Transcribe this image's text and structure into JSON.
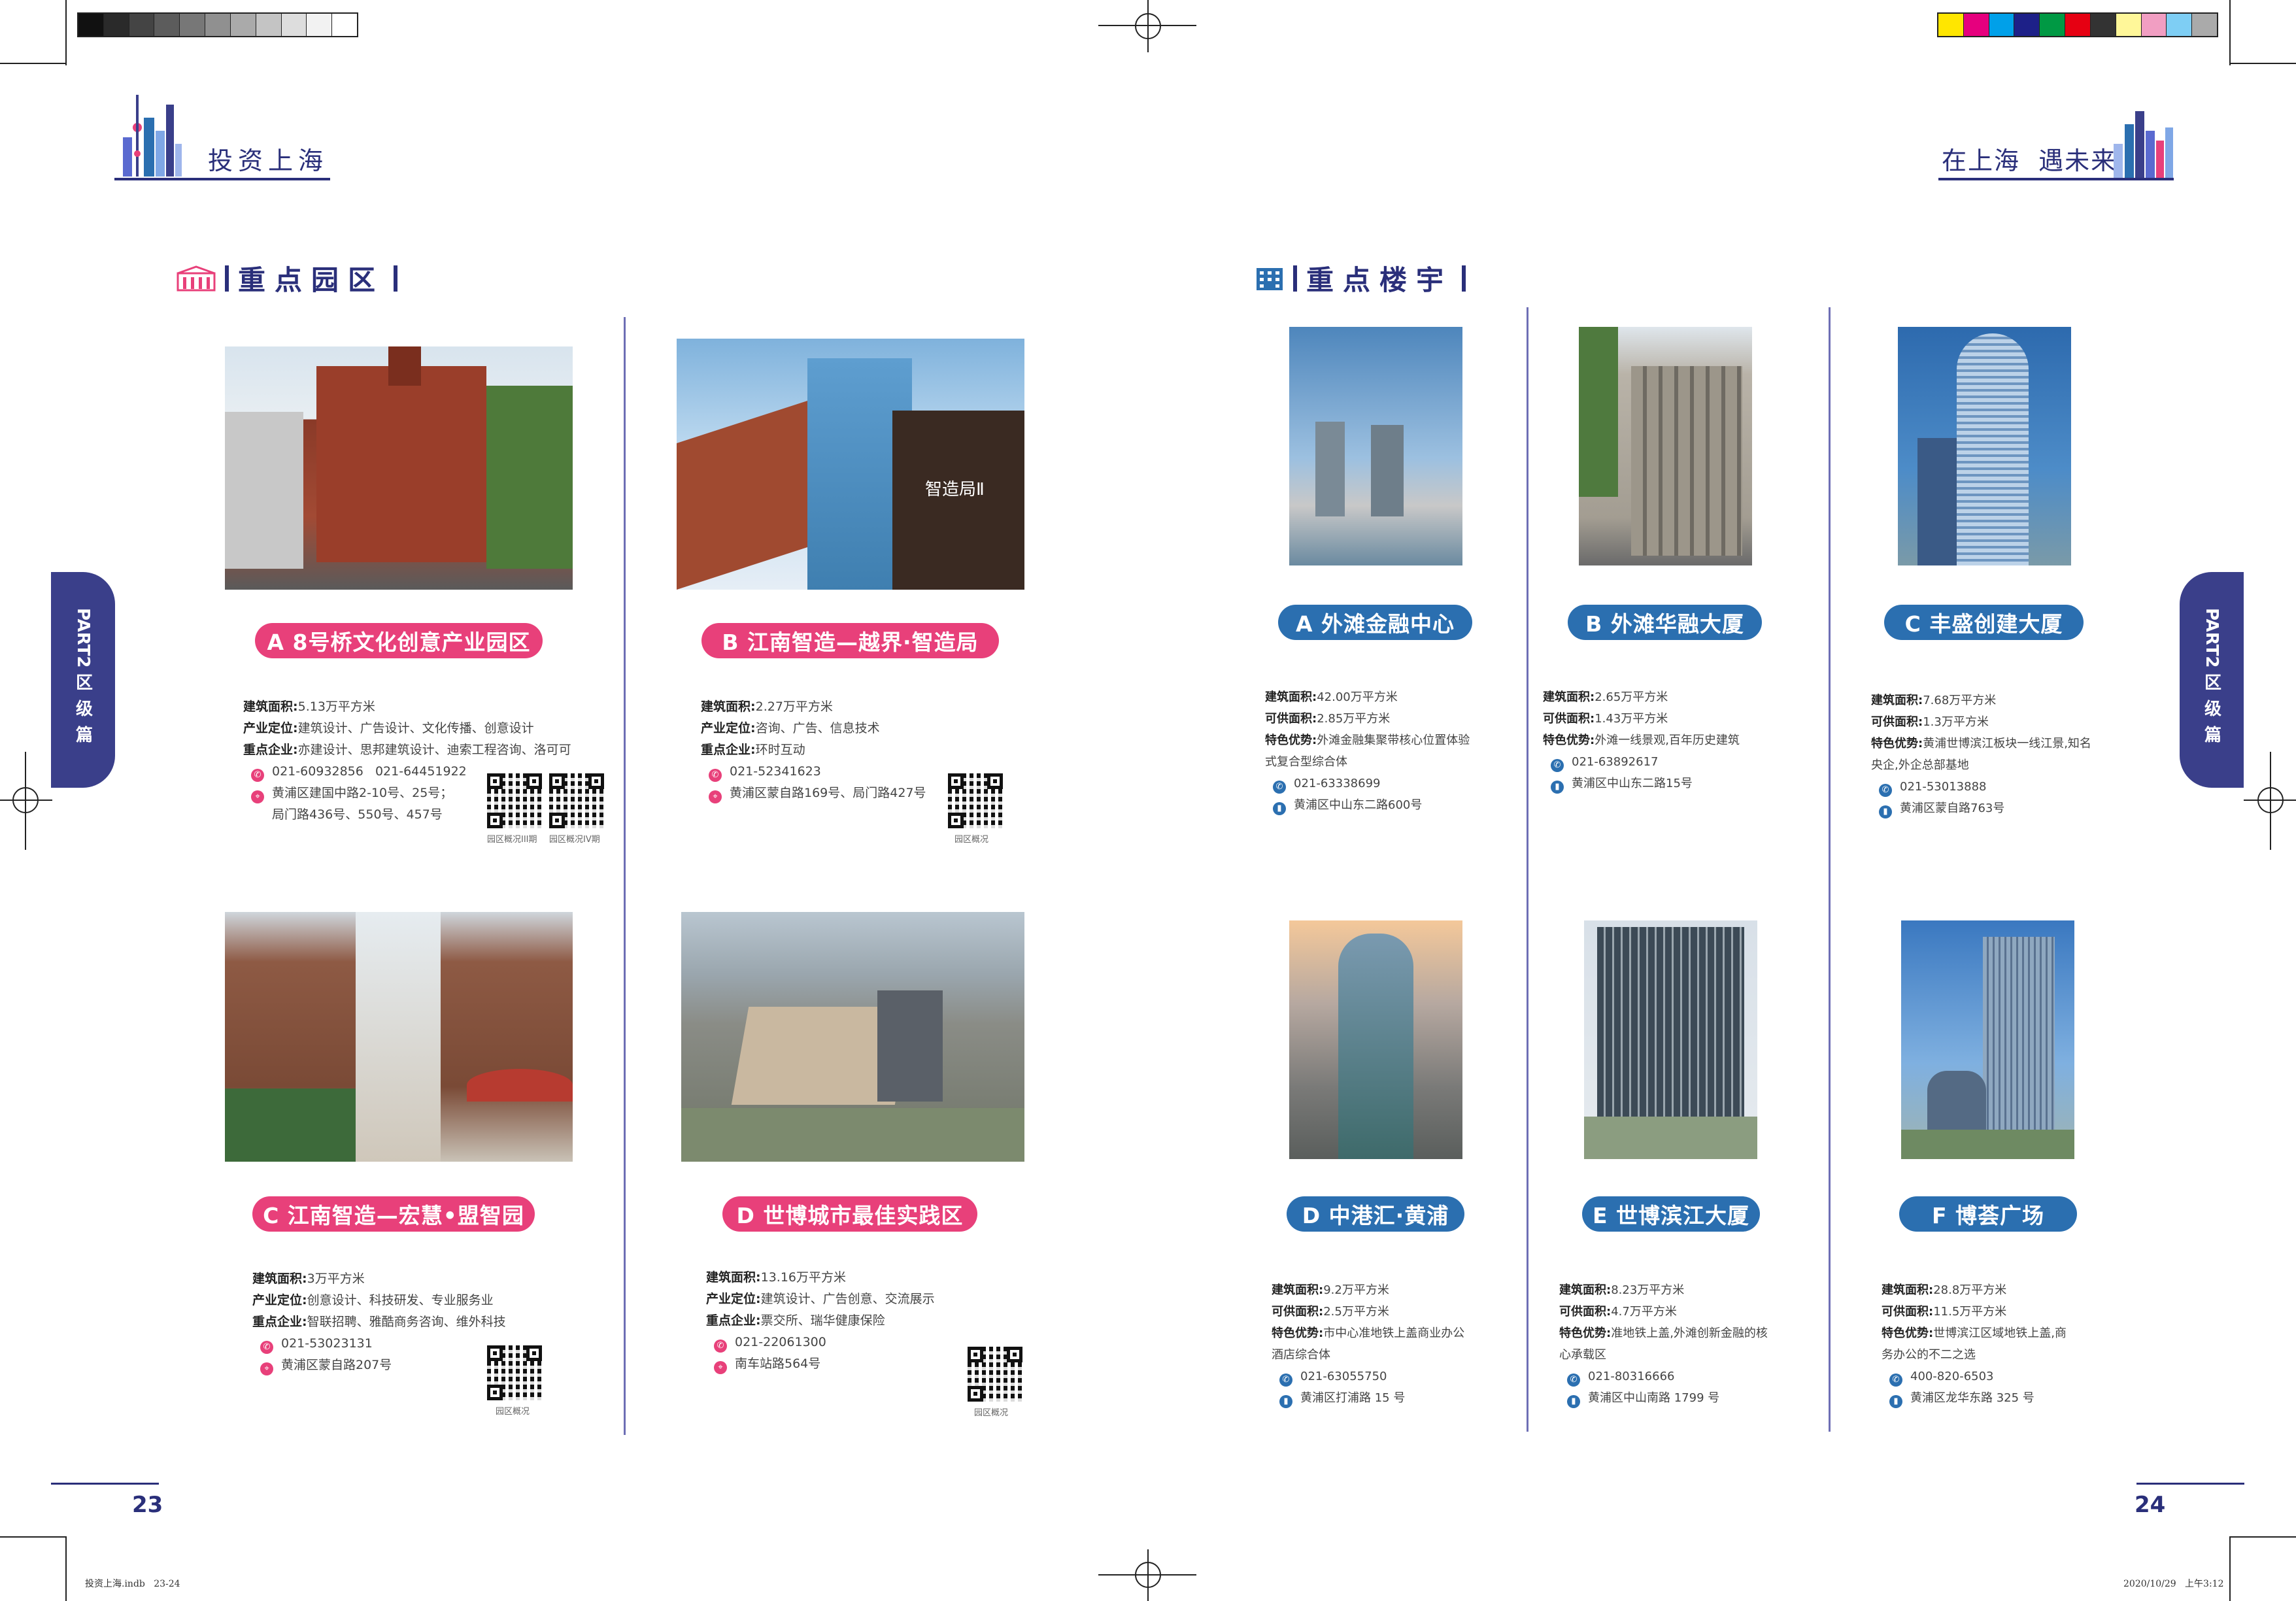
{
  "header_left": {
    "title": "投资上海"
  },
  "header_right": {
    "title": "在上海  遇未来"
  },
  "section_parks": {
    "title": "重点园区"
  },
  "section_buildings": {
    "title": "重点楼宇"
  },
  "side_tab_left": {
    "part": "PART2",
    "label": "区级篇"
  },
  "side_tab_right": {
    "part": "PART2",
    "label": "区级篇"
  },
  "parks": [
    {
      "name": "A 8号桥文化创意产业园区",
      "lines": [
        [
          "建筑面积:",
          "5.13万平方米"
        ],
        [
          "产业定位:",
          "建筑设计、广告设计、文化传播、创意设计"
        ],
        [
          "重点企业:",
          "亦建设计、思邦建筑设计、迪索工程咨询、洛可可"
        ]
      ],
      "phone": "021-60932856   021-64451922",
      "address": "黄浦区建国中路2-10号、25号；",
      "address2": "局门路436号、550号、457号",
      "qr_captions": [
        "园区概况III期",
        "园区概况IV期"
      ]
    },
    {
      "name": "B 江南智造—越界·智造局",
      "lines": [
        [
          "建筑面积:",
          "2.27万平方米"
        ],
        [
          "产业定位:",
          "咨询、广告、信息技术"
        ],
        [
          "重点企业:",
          "环时互动"
        ]
      ],
      "phone": "021-52341623",
      "address": "黄浦区蒙自路169号、局门路427号",
      "qr_captions": [
        "园区概况"
      ]
    },
    {
      "name": "C 江南智造—宏慧•盟智园",
      "lines": [
        [
          "建筑面积:",
          "3万平方米"
        ],
        [
          "产业定位:",
          "创意设计、科技研发、专业服务业"
        ],
        [
          "重点企业:",
          "智联招聘、雅酷商务咨询、维外科技"
        ]
      ],
      "phone": "021-53023131",
      "address": "黄浦区蒙自路207号",
      "qr_captions": [
        "园区概况"
      ]
    },
    {
      "name": "D 世博城市最佳实践区",
      "lines": [
        [
          "建筑面积:",
          "13.16万平方米"
        ],
        [
          "产业定位:",
          "建筑设计、广告创意、交流展示"
        ],
        [
          "重点企业:",
          "票交所、瑞华健康保险"
        ]
      ],
      "phone": "021-22061300",
      "address": "南车站路564号",
      "qr_captions": [
        "园区概况"
      ]
    }
  ],
  "buildings": [
    {
      "name": "A 外滩金融中心",
      "lines": [
        [
          "建筑面积:",
          "42.00万平方米"
        ],
        [
          "可供面积:",
          "2.85万平方米"
        ],
        [
          "特色优势:",
          "外滩金融集聚带核心位置体验"
        ]
      ],
      "extra": "式复合型综合体",
      "phone": "021-63338699",
      "address": "黄浦区中山东二路600号"
    },
    {
      "name": "B 外滩华融大厦",
      "lines": [
        [
          "建筑面积:",
          "2.65万平方米"
        ],
        [
          "可供面积:",
          "1.43万平方米"
        ],
        [
          "特色优势:",
          "外滩一线景观,百年历史建筑"
        ]
      ],
      "extra": "",
      "phone": "021-63892617",
      "address": "黄浦区中山东二路15号"
    },
    {
      "name": "C 丰盛创建大厦",
      "lines": [
        [
          "建筑面积:",
          "7.68万平方米"
        ],
        [
          "可供面积:",
          "1.3万平方米"
        ],
        [
          "特色优势:",
          "黄浦世博滨江板块一线江景,知名"
        ]
      ],
      "extra": "央企,外企总部基地",
      "phone": "021-53013888",
      "address": "黄浦区蒙自路763号"
    },
    {
      "name": "D 中港汇·黄浦",
      "lines": [
        [
          "建筑面积:",
          "9.2万平方米"
        ],
        [
          "可供面积:",
          "2.5万平方米"
        ],
        [
          "特色优势:",
          "市中心准地铁上盖商业办公"
        ]
      ],
      "extra": "酒店综合体",
      "phone": "021-63055750",
      "address": "黄浦区打浦路 15 号"
    },
    {
      "name": "E 世博滨江大厦",
      "lines": [
        [
          "建筑面积:",
          "8.23万平方米"
        ],
        [
          "可供面积:",
          "4.7万平方米"
        ],
        [
          "特色优势:",
          "准地铁上盖,外滩创新金融的核"
        ]
      ],
      "extra": "心承载区",
      "phone": "021-80316666",
      "address": "黄浦区中山南路 1799 号"
    },
    {
      "name": "F 博荟广场",
      "lines": [
        [
          "建筑面积:",
          "28.8万平方米"
        ],
        [
          "可供面积:",
          "11.5万平方米"
        ],
        [
          "特色优势:",
          "世博滨江区域地铁上盖,商"
        ]
      ],
      "extra": "务办公的不二之选",
      "phone": "400-820-6503",
      "address": "黄浦区龙华东路 325 号"
    }
  ],
  "page_numbers": {
    "left": "23",
    "right": "24"
  },
  "footer": {
    "left": "投资上海.indb   23-24",
    "right": "2020/10/29   上午3:12"
  },
  "colors": {
    "navy": "#2a2f7a",
    "pink": "#e8407a",
    "blue": "#2b6fb0",
    "divider": "#6e6fb5"
  }
}
